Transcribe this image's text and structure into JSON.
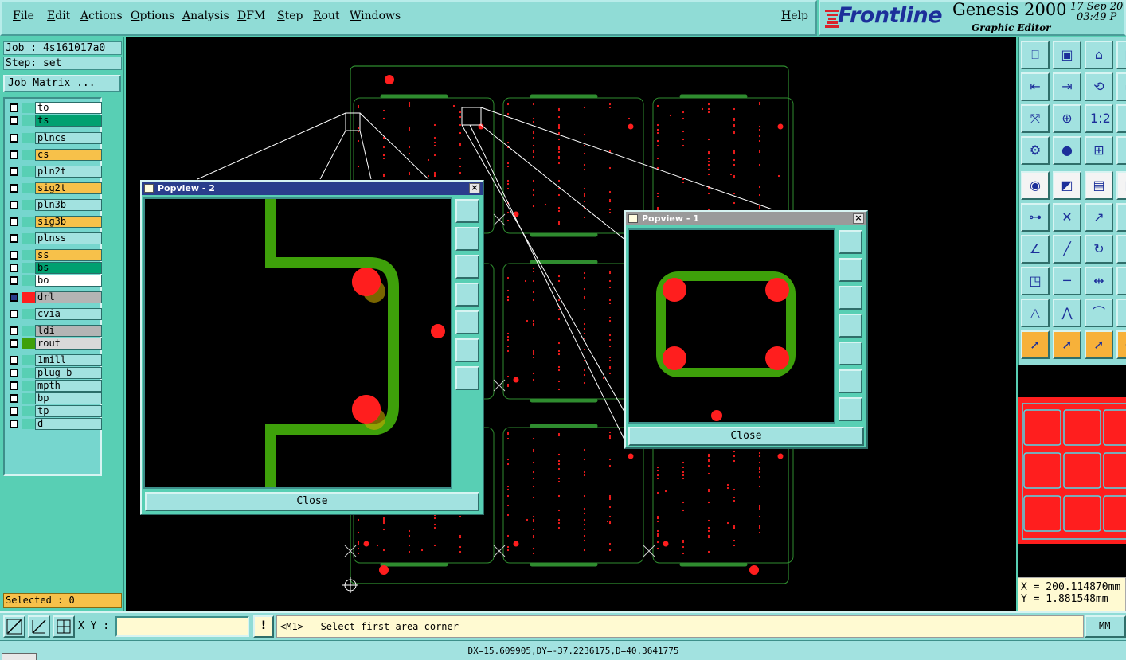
{
  "menu": [
    {
      "label": "File"
    },
    {
      "label": "Edit"
    },
    {
      "label": "Actions"
    },
    {
      "label": "Options"
    },
    {
      "label": "Analysis"
    },
    {
      "label": "DFM"
    },
    {
      "label": "Step"
    },
    {
      "label": "Rout"
    },
    {
      "label": "Windows"
    }
  ],
  "help_label": "Help",
  "brand": {
    "logo": "Frontline",
    "product": "Genesis 2000",
    "subtitle": "Graphic Editor",
    "date": "17 Sep 20",
    "time": "03:49 P"
  },
  "job": {
    "job_label": "Job : 4s161017a0",
    "step_label": "Step: set",
    "job_matrix_button": "Job Matrix ..."
  },
  "layers": [
    {
      "name": "to",
      "name_bg": "#ffffff",
      "swatch": ""
    },
    {
      "name": "ts",
      "name_bg": "#00a070",
      "swatch": ""
    },
    {
      "name": "plncs",
      "name_bg": "#a2e2e0",
      "swatch": ""
    },
    {
      "name": "cs",
      "name_bg": "#f7c14a",
      "swatch": ""
    },
    {
      "name": "pln2t",
      "name_bg": "#a2e2e0",
      "swatch": ""
    },
    {
      "name": "sig2t",
      "name_bg": "#f7c14a",
      "swatch": ""
    },
    {
      "name": "pln3b",
      "name_bg": "#a2e2e0",
      "swatch": ""
    },
    {
      "name": "sig3b",
      "name_bg": "#f7c14a",
      "swatch": ""
    },
    {
      "name": "plnss",
      "name_bg": "#a2e2e0",
      "swatch": ""
    },
    {
      "name": "ss",
      "name_bg": "#f7c14a",
      "swatch": ""
    },
    {
      "name": "bs",
      "name_bg": "#00a070",
      "swatch": ""
    },
    {
      "name": "bo",
      "name_bg": "#ffffff",
      "swatch": ""
    },
    {
      "name": "drl",
      "name_bg": "#b4b4b4",
      "swatch": "#ff1e1e",
      "checked": true
    },
    {
      "name": "cvia",
      "name_bg": "#a2e2e0",
      "swatch": ""
    },
    {
      "name": "ldi",
      "name_bg": "#b4b4b4",
      "swatch": ""
    },
    {
      "name": "rout",
      "name_bg": "#d8d8d8",
      "swatch": "#3ea00a"
    },
    {
      "name": "1mill",
      "name_bg": "#a2e2e0",
      "swatch": ""
    },
    {
      "name": "plug-b",
      "name_bg": "#a2e2e0",
      "swatch": ""
    },
    {
      "name": "mpth",
      "name_bg": "#a2e2e0",
      "swatch": ""
    },
    {
      "name": "bp",
      "name_bg": "#a2e2e0",
      "swatch": ""
    },
    {
      "name": "tp",
      "name_bg": "#a2e2e0",
      "swatch": ""
    },
    {
      "name": "d",
      "name_bg": "#a2e2e0",
      "swatch": ""
    }
  ],
  "selected_label": "Selected : 0",
  "popview2": {
    "title": "Popview - 2",
    "close_label": "Close",
    "title_bg": "#2a3e8c"
  },
  "popview1": {
    "title": "Popview - 1",
    "close_label": "Close",
    "title_bg": "#9a9a9a"
  },
  "coords": {
    "x": "X = 200.114870mm",
    "y": "Y = 1.881548mm"
  },
  "bottom": {
    "xy_label": "X Y :",
    "xy_value": "",
    "prompt": "<M1> - Select first area corner",
    "prompt_icon": "!",
    "units": "MM"
  },
  "status": "DX=15.609905,DY=-37.2236175,D=40.3641775",
  "colors": {
    "rout": "#3ea00a",
    "drill": "#ff1e1e",
    "outline": "#2f8c2f",
    "ui": "#90dcd6"
  }
}
